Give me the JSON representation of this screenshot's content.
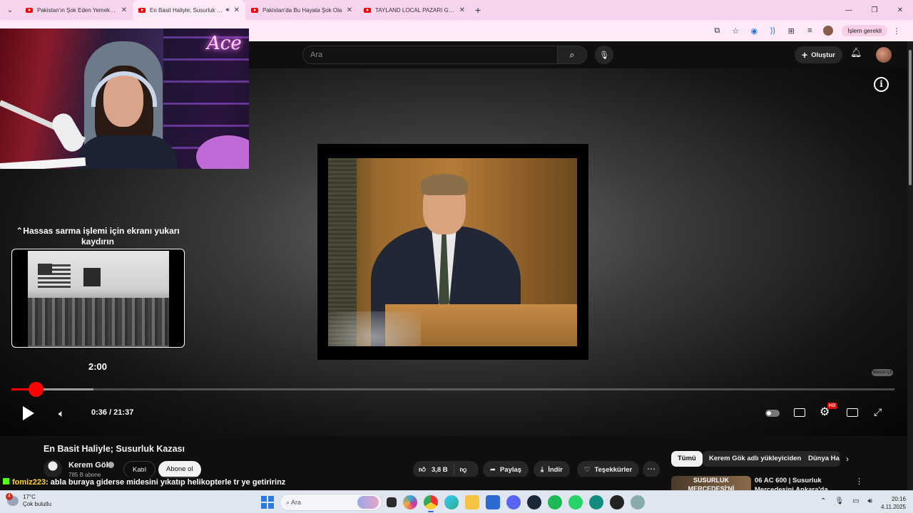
{
  "browser": {
    "tabs": [
      {
        "title": "Pakistan'ın Şok Eden Yemek Pa",
        "active": false
      },
      {
        "title": "En Basit Haliyle; Susurluk Ka",
        "active": true
      },
      {
        "title": "Pakistan'da Bu Hayata Şok Ola",
        "active": false
      },
      {
        "title": "TAYLAND LOCAL PAZARI GEZD",
        "active": false
      }
    ],
    "new_tab_label": "+",
    "action_pill": "İşlem gerekli"
  },
  "youtube": {
    "search_placeholder": "Ara",
    "create_label": "Oluştur"
  },
  "player": {
    "scrub_hint": "Hassas sarma işlemi için ekranı yukarı kaydırın",
    "preview_time": "2:00",
    "time_display": "0:36 / 21:37",
    "progress_fraction": 0.0278,
    "buffered_fraction": 0.093,
    "quality_badge": "HD",
    "watermark": "Meson Çil"
  },
  "video": {
    "title": "En Basit Haliyle; Susurluk Kazası",
    "channel": "Kerem Gök",
    "subscribers": "785 B abone",
    "join_label": "Katıl",
    "subscribe_label": "Abone ol",
    "likes": "3,8 B",
    "share_label": "Paylaş",
    "download_label": "İndir",
    "thanks_label": "Teşekkürler"
  },
  "sidebar": {
    "chips": [
      "Tümü",
      "Kerem Gök adlı yükleyiciden",
      "Dünya Ha"
    ],
    "rec_thumb_text": "SUSURLUK MERCEDESİ'Nİ",
    "rec_title": "06 AC 600 | Susurluk Mercedesini Ankara'da Bulduk!"
  },
  "overlay_chat": {
    "user": "fomiz223",
    "message": ": abla buraya giderse midesini yıkatıp helikopterle tr ye getiririnz"
  },
  "taskbar": {
    "temperature": "17°C",
    "weather": "Çok bulutlu",
    "weather_badge": "4",
    "search_placeholder": "Ara",
    "time": "20:16",
    "date": "4.11.2025"
  }
}
